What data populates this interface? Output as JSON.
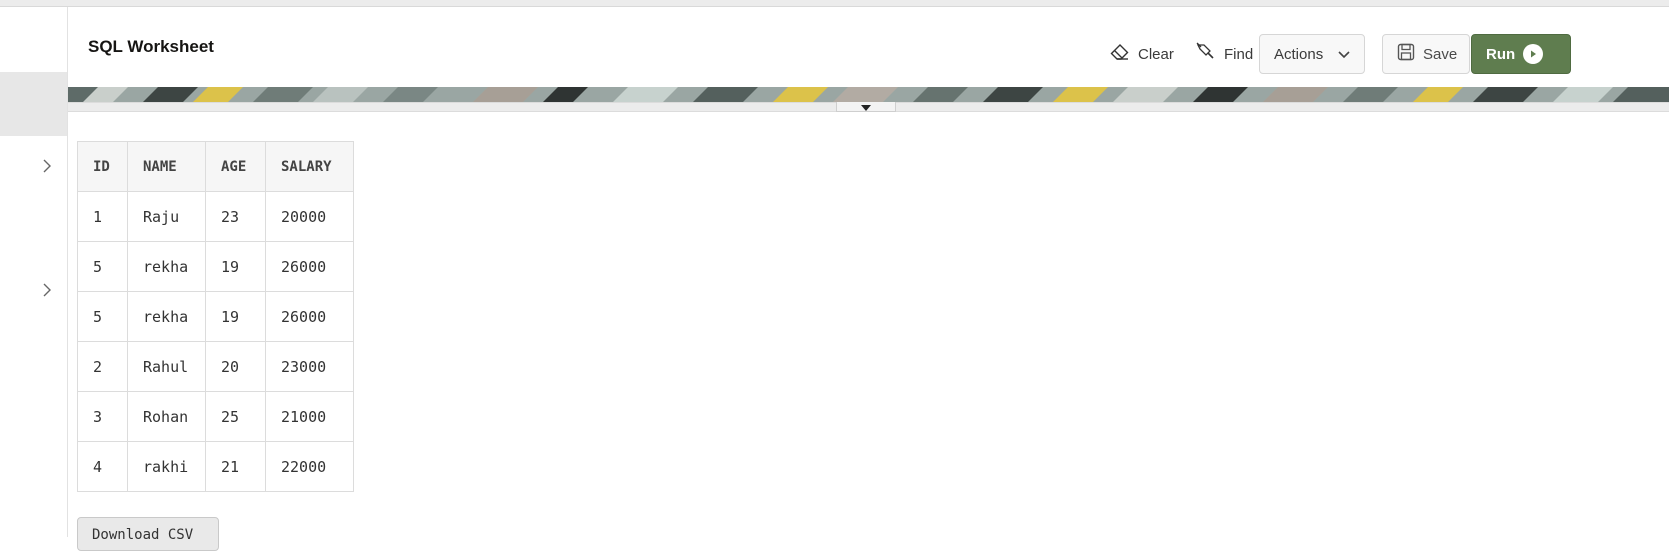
{
  "header": {
    "title": "SQL Worksheet",
    "toolbar": {
      "clear_label": "Clear",
      "find_label": "Find",
      "actions_label": "Actions",
      "save_label": "Save",
      "run_label": "Run"
    }
  },
  "results": {
    "columns": [
      "ID",
      "NAME",
      "AGE",
      "SALARY"
    ],
    "rows": [
      [
        "1",
        "Raju",
        "23",
        "20000"
      ],
      [
        "5",
        "rekha",
        "19",
        "26000"
      ],
      [
        "5",
        "rekha",
        "19",
        "26000"
      ],
      [
        "2",
        "Rahul",
        "20",
        "23000"
      ],
      [
        "3",
        "Rohan",
        "25",
        "21000"
      ],
      [
        "4",
        "rakhi",
        "21",
        "22000"
      ]
    ],
    "download_label": "Download CSV"
  },
  "icons": {
    "clear": "eraser-icon",
    "find": "find-flashlight-icon",
    "actions": "chevron-down-icon",
    "save": "floppy-disk-icon",
    "run": "play-circle-icon",
    "rail": "chevron-right-icon",
    "splitter": "caret-down-icon"
  },
  "colors": {
    "run_button": "#5f7d4f",
    "rail_selected": "#e7e7e7",
    "table_header_bg": "#f6f6f6"
  }
}
